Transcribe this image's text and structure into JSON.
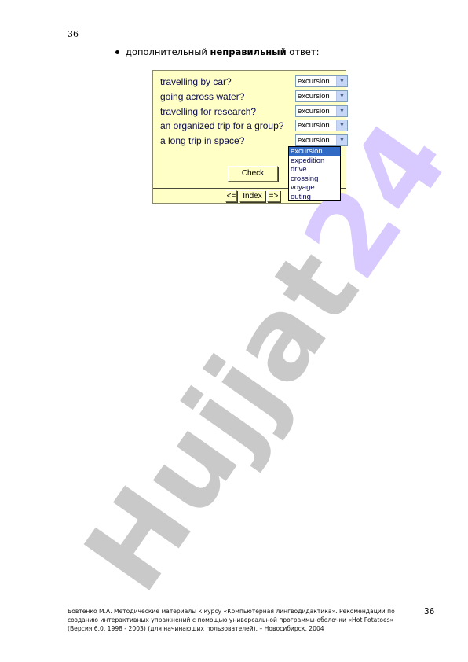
{
  "page_number_top": "36",
  "instruction": {
    "prefix": "дополнительный",
    "bold": "неправильный",
    "suffix": "ответ:"
  },
  "exercise": {
    "questions": [
      {
        "text": "travelling by car?",
        "selected": "excursion"
      },
      {
        "text": "going across water?",
        "selected": "excursion"
      },
      {
        "text": "travelling for research?",
        "selected": "excursion"
      },
      {
        "text": "an organized trip for a group?",
        "selected": "excursion"
      },
      {
        "text": "a long trip in space?",
        "selected": "excursion"
      }
    ],
    "dropdown_options": [
      "excursion",
      "expedition",
      "drive",
      "crossing",
      "voyage",
      "outing"
    ],
    "dropdown_highlighted": "excursion",
    "check_label": "Check",
    "nav": {
      "prev_label": "<=",
      "index_label": "Index",
      "next_label": "=>"
    },
    "colors": {
      "background": "#ffffc6",
      "question_text": "#0a0a50",
      "highlight": "#316ac5"
    }
  },
  "watermark": {
    "main": "Hujjat",
    "accent": "24"
  },
  "footer": {
    "text": "Бовтенко М.А. Методические материалы к курсу «Компьютерная лингводидактика». Рекомендации по созданию интерактивных упражнений с помощью универсальной программы-оболочки «Hot Potatoes» (Версия 6.0. 1998 - 2003) (для начинающих пользователей). – Новосибирск, 2004",
    "page_number": "36"
  }
}
